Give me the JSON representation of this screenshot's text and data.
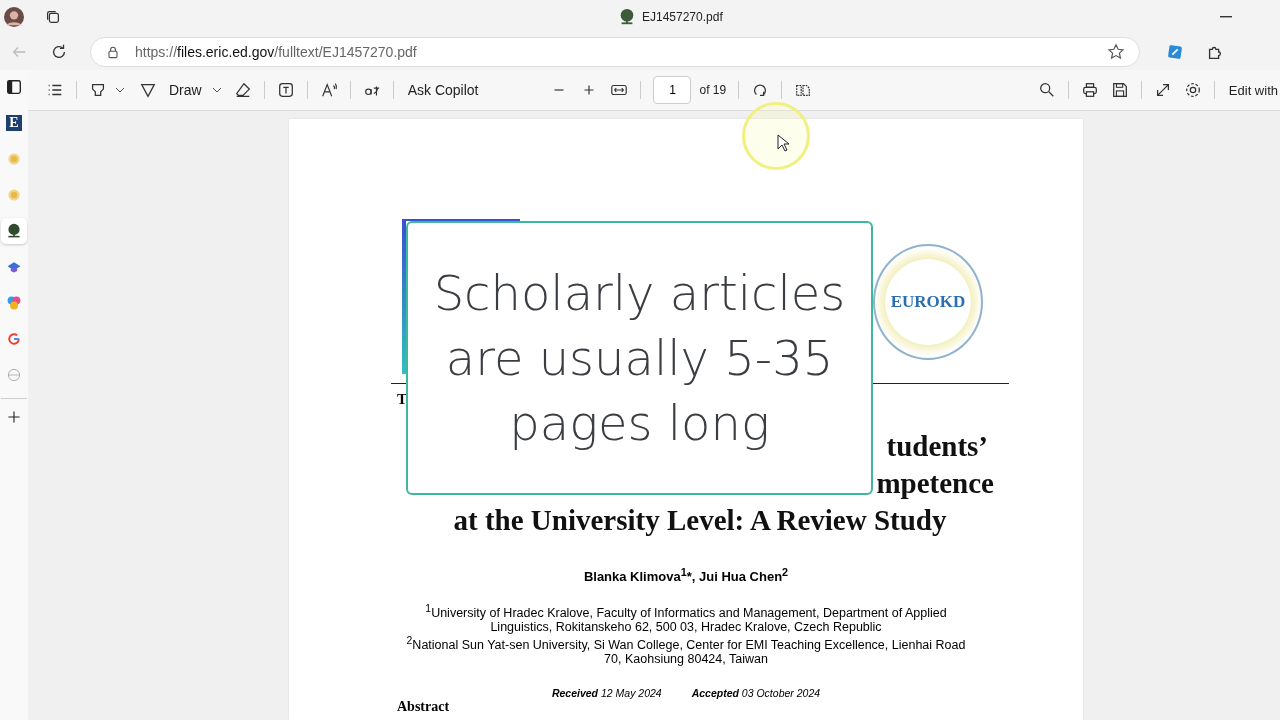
{
  "window": {
    "title": "EJ1457270.pdf"
  },
  "address_bar": {
    "scheme": "https://",
    "host": "files.eric.ed.gov",
    "path": "/fulltext/EJ1457270.pdf"
  },
  "toolbar": {
    "draw_label": "Draw",
    "copilot_label": "Ask Copilot",
    "page_number": "1",
    "page_count": "of 19",
    "edit_label": "Edit with"
  },
  "sidebar": {
    "items": [
      {
        "kind": "letter",
        "label": "E",
        "selected": false
      },
      {
        "kind": "sun",
        "selected": false
      },
      {
        "kind": "sun",
        "selected": false
      },
      {
        "kind": "tree",
        "selected": true
      },
      {
        "kind": "cap",
        "selected": false
      },
      {
        "kind": "copilot",
        "selected": false
      },
      {
        "kind": "google",
        "selected": false
      },
      {
        "kind": "globe",
        "selected": false
      }
    ]
  },
  "document": {
    "logo_text": "EUROKD",
    "header_fragment": "T",
    "title_fragments": [
      "tudents’",
      "mpetence"
    ],
    "title_line": "at the University Level: A Review Study",
    "authors": "Blanka Klimova$^{1}$*, Jui Hua Chen$^{2}$",
    "affiliations": [
      "$^{1}$University of Hradec Kralove, Faculty of Informatics and Management, Department of Applied Linguistics, Rokitanskeho 62, 500 03, Hradec Kralove, Czech Republic",
      "$^{2}$National Sun Yat-sen University, Si Wan College, Center for EMI Teaching Excellence,  Lienhai Road 70, Kaohsiung 80424, Taiwan"
    ],
    "dates": [
      "**Received** 12 May 2024",
      "**Accepted** 03 October 2024"
    ],
    "abstract_heading": "Abstract"
  },
  "overlay": {
    "text": "Scholarly articles are usually 5-35 pages long"
  }
}
